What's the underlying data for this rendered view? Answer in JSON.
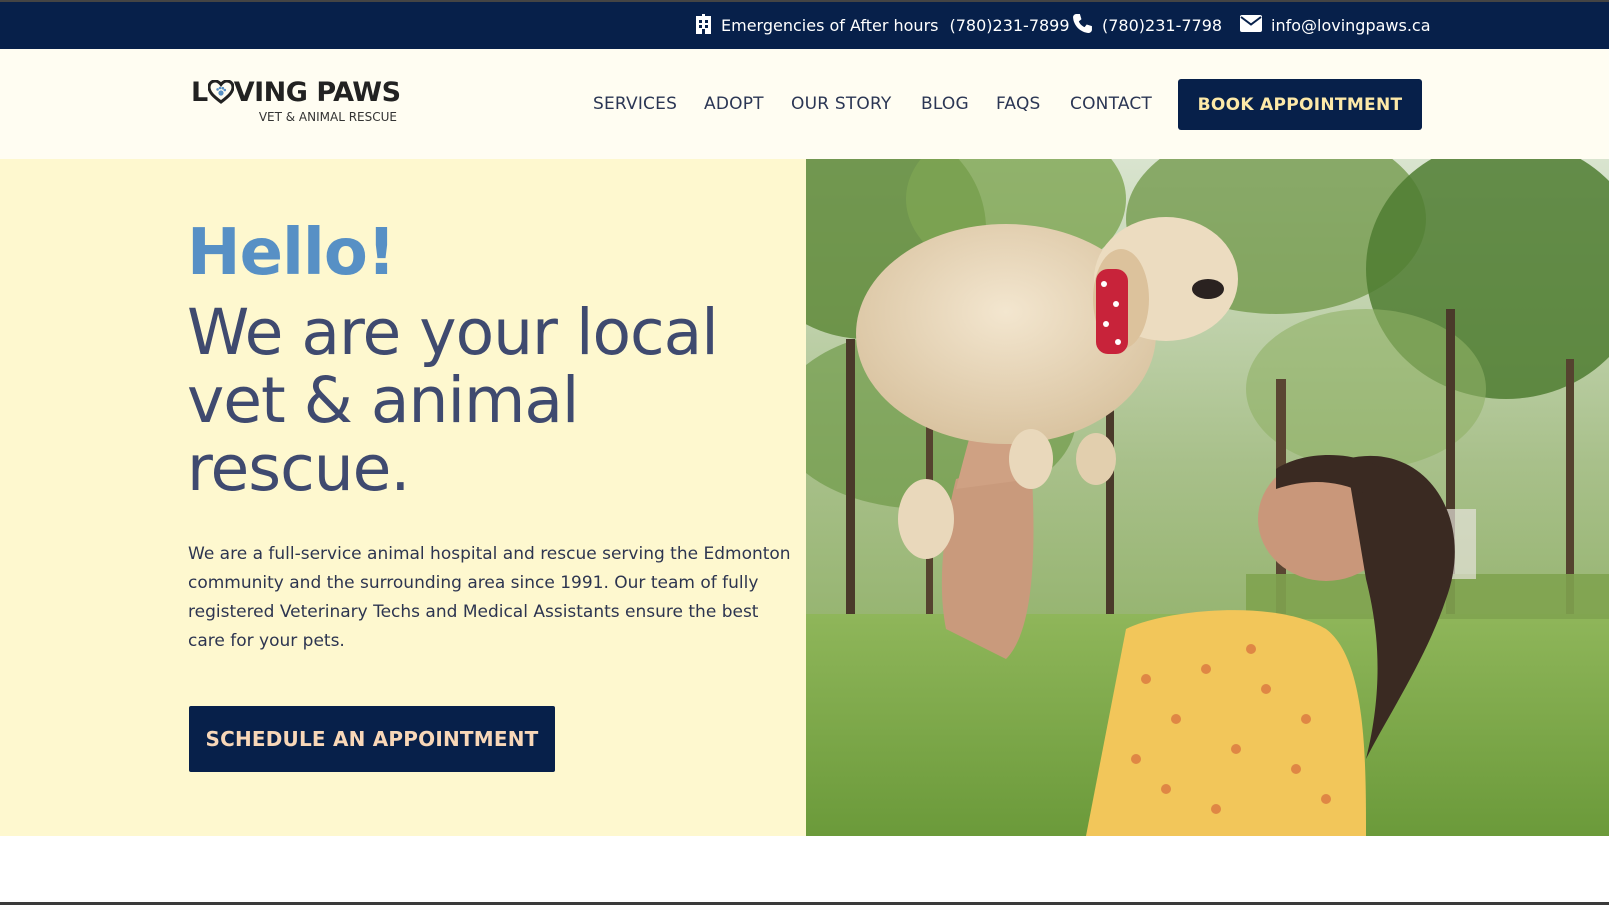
{
  "topbar": {
    "emergency_label": "Emergencies of After hours",
    "emergency_phone": "(780)231-7899",
    "phone": "(780)231-7798",
    "email": "info@lovingpaws.ca",
    "icons": [
      "hospital-icon",
      "phone-icon",
      "envelope-icon"
    ]
  },
  "logo": {
    "title_left": "L",
    "title_right": "VING PAWS",
    "subtitle": "VET & ANIMAL RESCUE"
  },
  "nav": {
    "items": [
      "SERVICES",
      "ADOPT",
      "OUR STORY",
      "BLOG",
      "FAQS",
      "CONTACT"
    ],
    "cta": "BOOK APPOINTMENT"
  },
  "hero": {
    "greeting": "Hello!",
    "headline": "We are your local vet & animal rescue.",
    "body": "We are a full-service animal hospital and rescue serving the Edmonton community and the surrounding area since 1991. Our team of fully registered Veterinary Techs and Medical Assistants ensure the best care for your pets.",
    "cta": "SCHEDULE AN APPOINTMENT"
  },
  "colors": {
    "navy": "#07204a",
    "hero_bg": "#fef8cf",
    "header_bg": "#fffdf2",
    "greeting_blue": "#5790c5",
    "headline": "#3f4a6f",
    "button_text_book": "#fde9a8",
    "button_text_schedule": "#f8d7b8"
  }
}
